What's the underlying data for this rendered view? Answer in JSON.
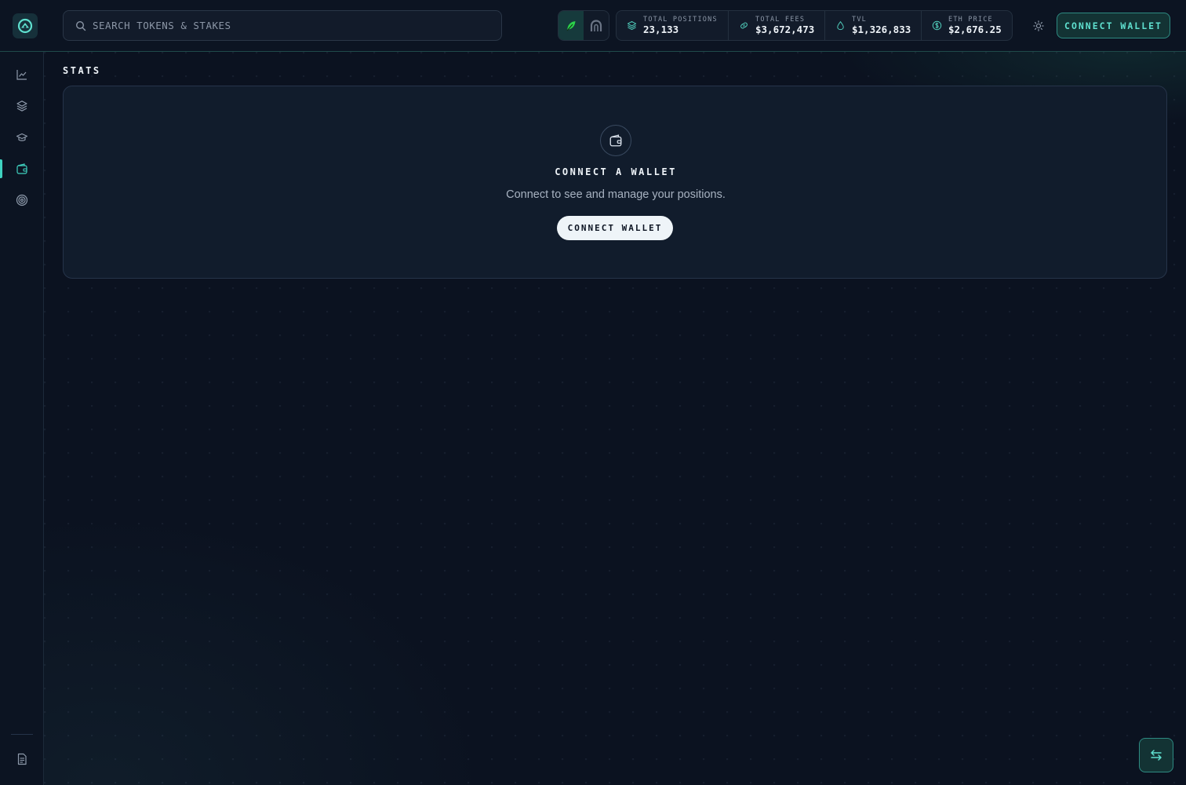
{
  "header": {
    "logo_icon": "app-logo-icon",
    "search": {
      "placeholder": "SEARCH TOKENS & STAKES",
      "value": ""
    },
    "protocols": [
      {
        "name": "feather-icon",
        "active": true
      },
      {
        "name": "arch-icon",
        "active": false
      }
    ],
    "stats": [
      {
        "icon": "layers-icon",
        "label": "TOTAL POSITIONS",
        "value": "23,133"
      },
      {
        "icon": "link-icon",
        "label": "TOTAL FEES",
        "value": "$3,672,473"
      },
      {
        "icon": "droplet-icon",
        "label": "TVL",
        "value": "$1,326,833"
      },
      {
        "icon": "dollar-circle-icon",
        "label": "ETH PRICE",
        "value": "$2,676.25"
      }
    ],
    "theme_icon": "sun-icon",
    "connect_label": "CONNECT WALLET"
  },
  "sidebar": {
    "items": [
      {
        "icon": "chart-line-icon",
        "active": false
      },
      {
        "icon": "layers-icon",
        "active": false
      },
      {
        "icon": "graduation-cap-icon",
        "active": false
      },
      {
        "icon": "wallet-icon",
        "active": true
      },
      {
        "icon": "target-icon",
        "active": false
      }
    ],
    "footer_icon": "document-icon"
  },
  "main": {
    "section_title": "STATS",
    "card": {
      "icon": "wallet-icon",
      "title": "CONNECT A WALLET",
      "description": "Connect to see and manage your positions.",
      "button_label": "CONNECT WALLET"
    }
  },
  "fab_icon": "swap-arrows-icon",
  "colors": {
    "accent": "#3fd2c0",
    "background": "#0b1220",
    "panel": "#111c2c",
    "active_protocol": "#2bd14a"
  }
}
